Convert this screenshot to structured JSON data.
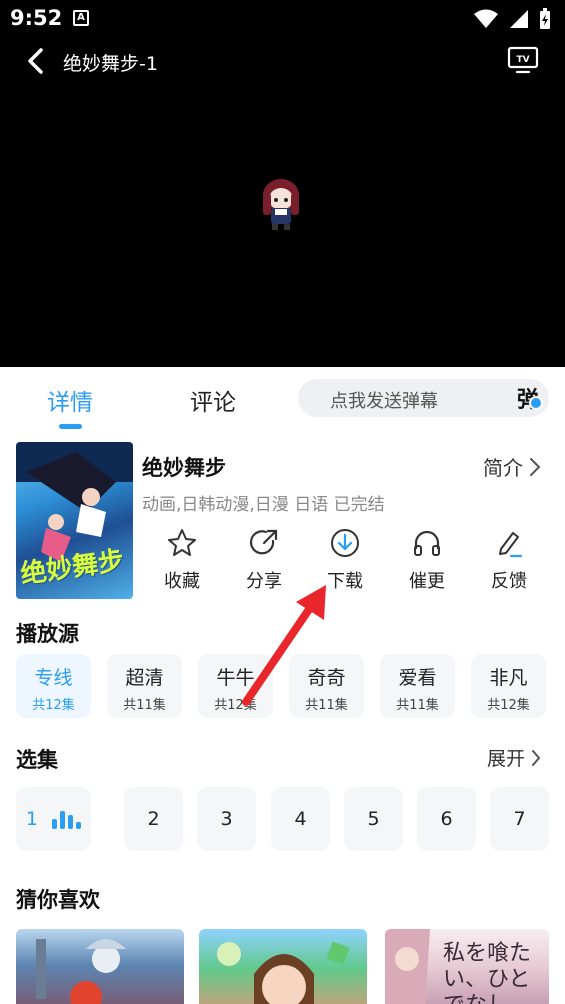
{
  "status_bar": {
    "time": "9:52",
    "notif_glyph": "A"
  },
  "player": {
    "title": "绝妙舞步-1",
    "back_icon": "chevron-left-icon",
    "tv_icon": "tv-cast-icon"
  },
  "tabs": {
    "details": "详情",
    "comments": "评论"
  },
  "danmaku": {
    "placeholder": "点我发送弹幕",
    "toggle_label": "弹"
  },
  "anime": {
    "title": "绝妙舞步",
    "intro_label": "简介",
    "meta": "动画,日韩动漫,日漫 日语 已完结",
    "poster_art_text": "绝妙舞步"
  },
  "actions": [
    {
      "label": "收藏",
      "icon": "star-icon"
    },
    {
      "label": "分享",
      "icon": "share-icon"
    },
    {
      "label": "下载",
      "icon": "download-icon"
    },
    {
      "label": "催更",
      "icon": "headphones-icon"
    },
    {
      "label": "反馈",
      "icon": "edit-icon"
    }
  ],
  "sources": {
    "title": "播放源",
    "items": [
      {
        "name": "专线",
        "count": "共12集"
      },
      {
        "name": "超清",
        "count": "共11集"
      },
      {
        "name": "牛牛",
        "count": "共12集"
      },
      {
        "name": "奇奇",
        "count": "共11集"
      },
      {
        "name": "爱看",
        "count": "共11集"
      },
      {
        "name": "非凡",
        "count": "共12集"
      }
    ]
  },
  "episodes": {
    "title": "选集",
    "expand_label": "展开",
    "items": [
      "1",
      "2",
      "3",
      "4",
      "5",
      "6",
      "7"
    ]
  },
  "recommendations": {
    "title": "猜你喜欢",
    "rec3_art_text": "私を喰たい、ひとでなし"
  },
  "colors": {
    "accent": "#2a9df4",
    "annotation_arrow": "#e8262b"
  }
}
